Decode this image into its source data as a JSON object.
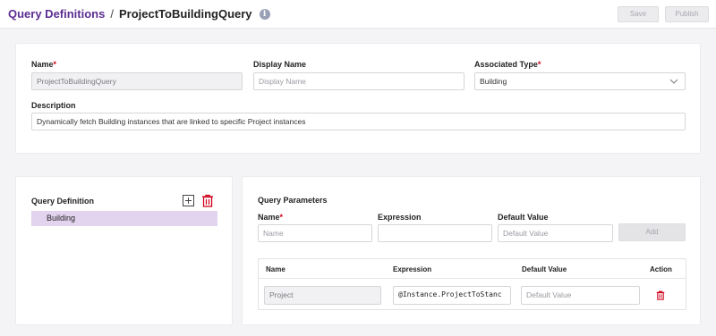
{
  "header": {
    "breadcrumb_root": "Query Definitions",
    "separator": "/",
    "title": "ProjectToBuildingQuery",
    "info_icon": "info-icon",
    "save_label": "Save",
    "publish_label": "Publish"
  },
  "details": {
    "name_label": "Name",
    "name_value": "ProjectToBuildingQuery",
    "display_name_label": "Display Name",
    "display_name_placeholder": "Display Name",
    "associated_type_label": "Associated Type",
    "associated_type_value": "Building",
    "description_label": "Description",
    "description_value": "Dynamically fetch Building instances that are linked to specific Project instances",
    "required_marker": "*"
  },
  "query_definition": {
    "title": "Query Definition",
    "add_icon": "plus-square-icon",
    "delete_icon": "trash-icon",
    "items": [
      {
        "label": "Building"
      }
    ]
  },
  "query_parameters": {
    "title": "Query Parameters",
    "name_label": "Name",
    "name_placeholder": "Name",
    "expression_label": "Expression",
    "expression_value": "",
    "default_value_label": "Default Value",
    "default_value_placeholder": "Default Value",
    "add_label": "Add",
    "table": {
      "columns": [
        "Name",
        "Expression",
        "Default Value",
        "Action"
      ],
      "rows": [
        {
          "name": "Project",
          "expression": "@Instance.ProjectToStanc",
          "default_value_placeholder": "Default Value",
          "action_icon": "trash-icon"
        }
      ]
    }
  },
  "colors": {
    "accent": "#5c2d91",
    "selected_row": "#e2d3ee",
    "danger": "#d0021b"
  }
}
